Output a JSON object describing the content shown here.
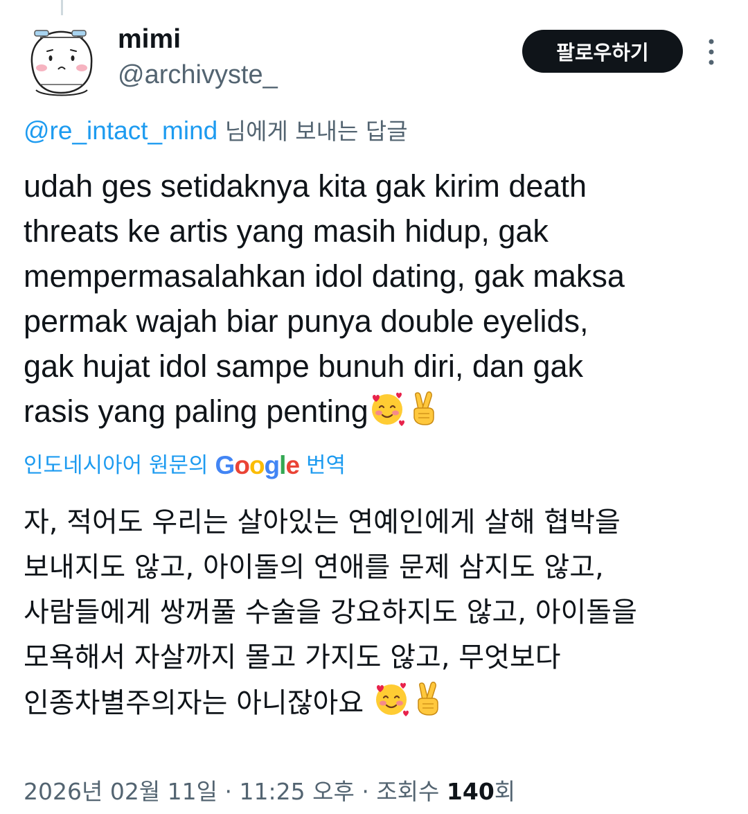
{
  "author": {
    "display_name": "mimi",
    "handle": "@archivyste_"
  },
  "follow_label": "팔로우하기",
  "reply": {
    "mention": "@re_intact_mind",
    "suffix": " 님에게 보내는 답글"
  },
  "tweet": {
    "lines": [
      "udah ges setidaknya kita gak kirim death",
      "threats ke artis yang masih hidup, gak",
      "mempermasalahkan idol dating, gak maksa",
      "permak wajah biar punya double eyelids,",
      "gak hujat idol sampe bunuh diri, dan gak",
      "rasis yang paling penting"
    ],
    "emojis": [
      "smiling-face-with-hearts-icon",
      "crossed-fingers-icon"
    ]
  },
  "translation": {
    "prefix": "인도네시아어 원문의",
    "google_letters": [
      "G",
      "o",
      "o",
      "g",
      "l",
      "e"
    ],
    "suffix": "번역",
    "lines": [
      "자, 적어도 우리는 살아있는 연예인에게 살해 협박을",
      "보내지도 않고, 아이돌의 연애를 문제 삼지도 않고,",
      "사람들에게 쌍꺼풀 수술을 강요하지도 않고, 아이돌을",
      "모욕해서 자살까지 몰고 가지도 않고, 무엇보다",
      "인종차별주의자는 아니잖아요"
    ]
  },
  "meta": {
    "date": "2026년 02월 11일",
    "separator": " · ",
    "time": "11:25 오후",
    "views_label": "조회수",
    "views_count": "140",
    "views_unit": "회"
  },
  "colors": {
    "accent": "#1d9bf0",
    "secondary_text": "#536471",
    "primary_text": "#0f1419"
  }
}
